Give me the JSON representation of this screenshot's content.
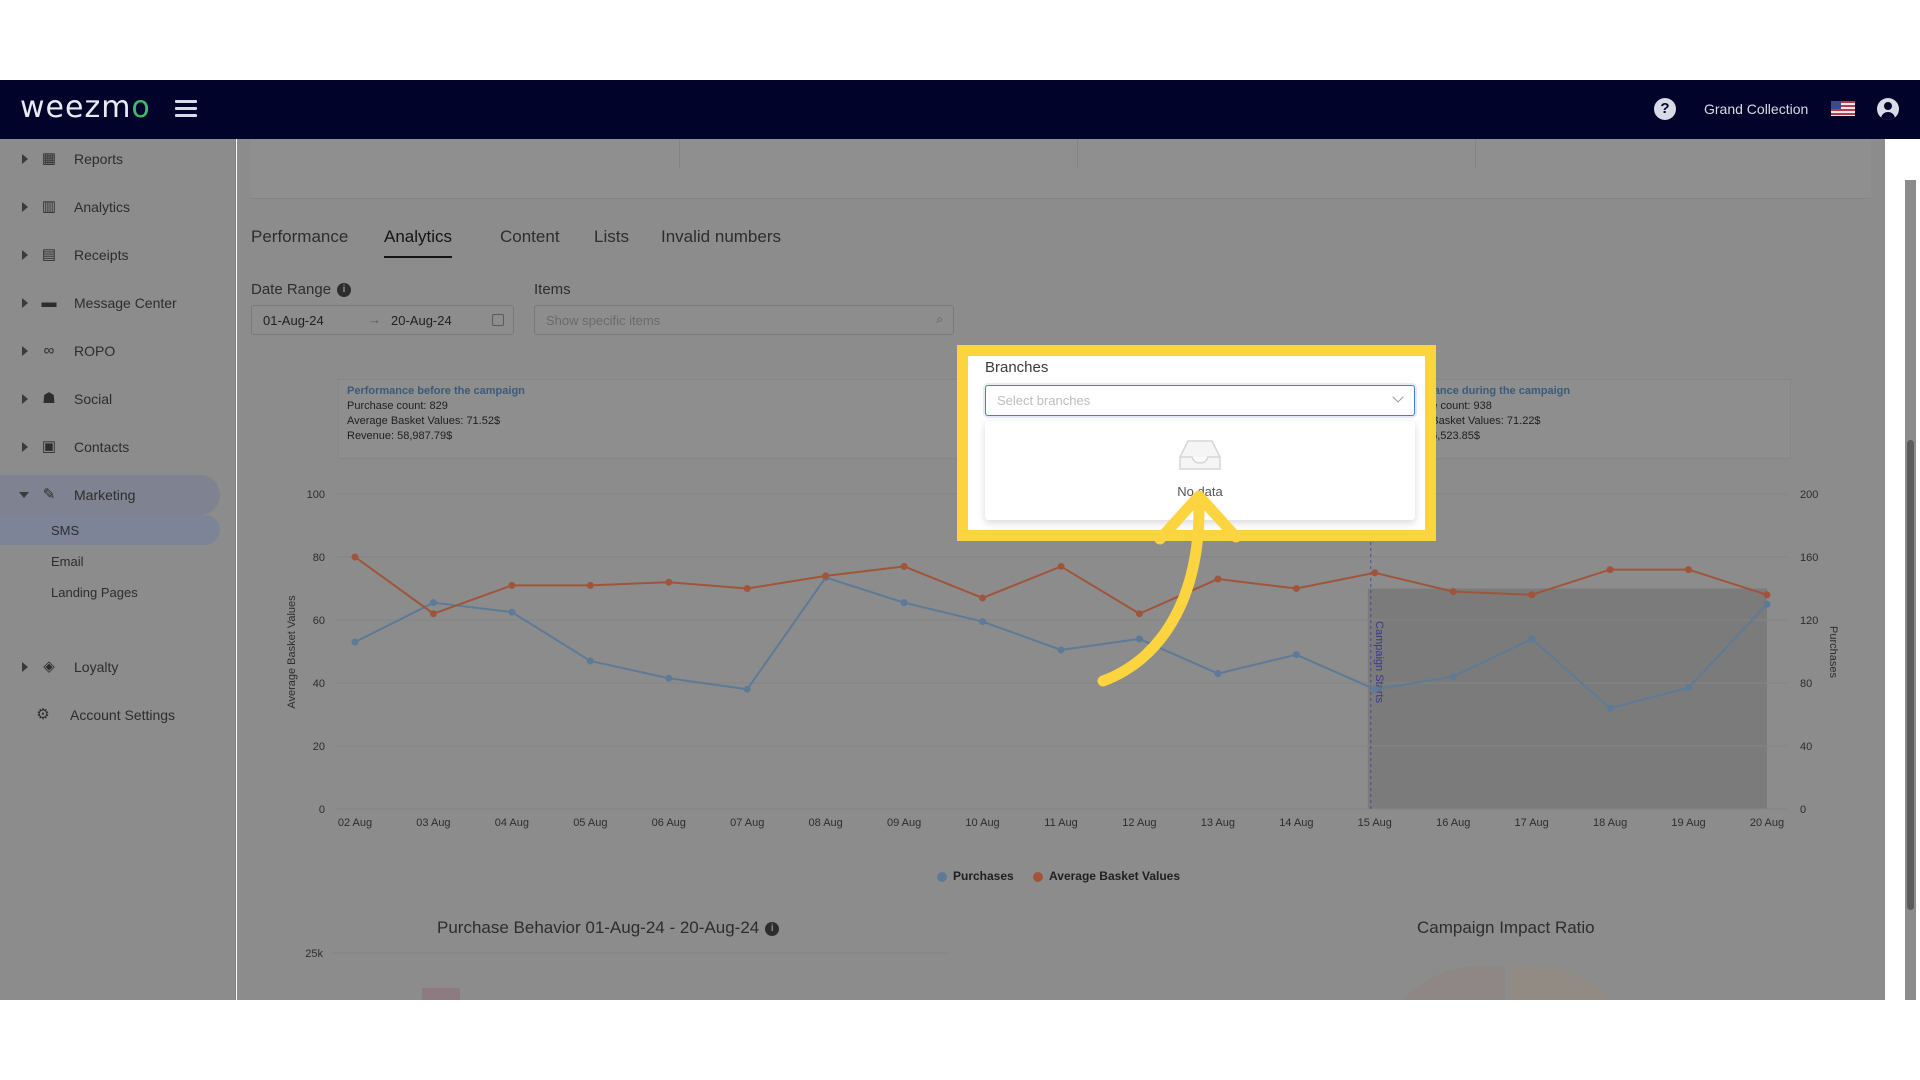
{
  "brand": {
    "logo_text_a": "weezm",
    "logo_text_o": "o"
  },
  "header": {
    "org_name": "Grand Collection",
    "help_symbol": "?",
    "icons": [
      "menu-icon",
      "help-icon",
      "us-flag-icon",
      "user-icon"
    ]
  },
  "sidebar": {
    "items": [
      {
        "label": "Reports",
        "icon": "dashboard-icon",
        "symbol": "▦"
      },
      {
        "label": "Analytics",
        "icon": "analytics-icon",
        "symbol": "▥"
      },
      {
        "label": "Receipts",
        "icon": "receipt-icon",
        "symbol": "▤"
      },
      {
        "label": "Message Center",
        "icon": "message-icon",
        "symbol": "▬"
      },
      {
        "label": "ROPO",
        "icon": "infinity-icon",
        "symbol": "∞"
      },
      {
        "label": "Social",
        "icon": "people-icon",
        "symbol": "☗"
      },
      {
        "label": "Contacts",
        "icon": "contacts-icon",
        "symbol": "▣"
      },
      {
        "label": "Marketing",
        "icon": "megaphone-icon",
        "symbol": "✎"
      },
      {
        "label": "Loyalty",
        "icon": "tag-icon",
        "symbol": "◈"
      },
      {
        "label": "Account Settings",
        "icon": "gear-icon",
        "symbol": "⚙"
      }
    ],
    "marketing_sub": [
      "SMS",
      "Email",
      "Landing Pages"
    ],
    "active_item": "Marketing",
    "active_sub": "SMS"
  },
  "tabs": [
    "Performance",
    "Analytics",
    "Content",
    "Lists",
    "Invalid numbers"
  ],
  "active_tab": "Analytics",
  "filters": {
    "date_range_label": "Date Range",
    "date_from": "01-Aug-24",
    "date_to": "20-Aug-24",
    "date_arrow": "→",
    "items_label": "Items",
    "items_placeholder": "Show specific items",
    "search_symbol": "🔍",
    "info_symbol": "i"
  },
  "branches_popup": {
    "label": "Branches",
    "placeholder": "Select branches",
    "empty_text": "No data"
  },
  "obscured_text": "ur",
  "stat_before": {
    "title": "Performance before the campaign",
    "line1": "Purchase count: 829",
    "line2": "Average Basket Values: 71.52$",
    "line3": "Revenue: 58,987.79$"
  },
  "stat_during": {
    "title": "mance during the campaign",
    "line1": "ha  e count: 938",
    "line2": "ag  Basket Values: 71.22$",
    "line3": "Reven  : 66,523.85$"
  },
  "chart_data": {
    "type": "line",
    "categories": [
      "02 Aug",
      "03 Aug",
      "04 Aug",
      "05 Aug",
      "06 Aug",
      "07 Aug",
      "08 Aug",
      "09 Aug",
      "10 Aug",
      "11 Aug",
      "12 Aug",
      "13 Aug",
      "14 Aug",
      "15 Aug",
      "16 Aug",
      "17 Aug",
      "18 Aug",
      "19 Aug",
      "20 Aug"
    ],
    "series": [
      {
        "name": "Purchases",
        "axis": "right",
        "color": "#5d7a98",
        "values": [
          106,
          131,
          125,
          94,
          83,
          76,
          147,
          131,
          119,
          101,
          108,
          86,
          98,
          76,
          84,
          108,
          64,
          77,
          130
        ]
      },
      {
        "name": "Average Basket Values",
        "axis": "left",
        "color": "#a0553a",
        "values": [
          80,
          62,
          71,
          71,
          72,
          70,
          74,
          77,
          67,
          77,
          62,
          73,
          70,
          75,
          69,
          68,
          76,
          76,
          68
        ]
      }
    ],
    "ylabel_left": "Average Basket Values",
    "ylabel_right": "Purchases",
    "ylim_left": [
      0,
      100
    ],
    "ylim_right": [
      0,
      200
    ],
    "yticks_left": [
      "0",
      "20",
      "40",
      "60",
      "80",
      "100"
    ],
    "yticks_right": [
      "0",
      "40",
      "80",
      "120",
      "160",
      "200"
    ],
    "campaign_start_label": "Campaign Starts",
    "campaign_start_category": "15 Aug",
    "grid": true,
    "legend": "bottom-center"
  },
  "purchase_behavior": {
    "title": "Purchase Behavior 01-Aug-24 - 20-Aug-24",
    "ytick": "25k"
  },
  "campaign_impact": {
    "title": "Campaign Impact Ratio"
  },
  "colors": {
    "highlight": "#fcd43f",
    "nav_bg": "#02032a",
    "overlay": "#8c8c8c"
  }
}
